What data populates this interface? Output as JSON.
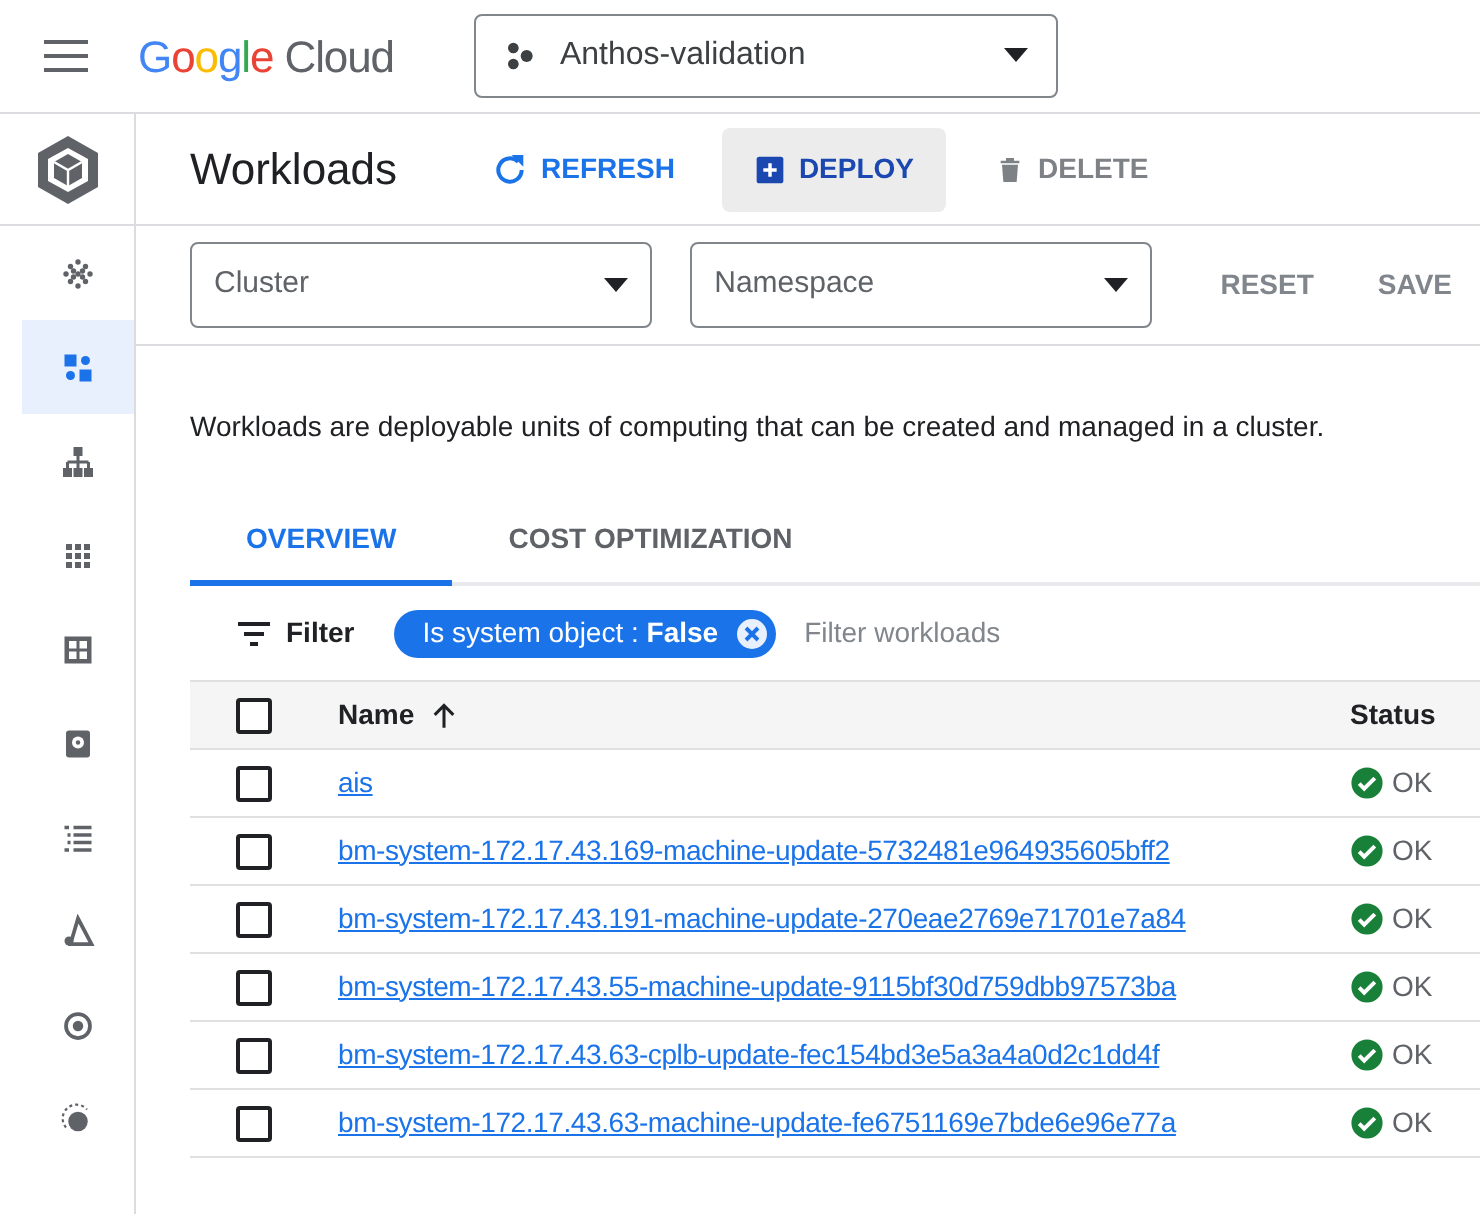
{
  "top_bar": {
    "logo": "Google Cloud",
    "project": "Anthos-validation"
  },
  "sidebar": {
    "items": [
      {
        "kind": "dots",
        "selected": false
      },
      {
        "kind": "workloads",
        "selected": true
      },
      {
        "kind": "hierarchy",
        "selected": false
      },
      {
        "kind": "grid",
        "selected": false
      },
      {
        "kind": "tiles",
        "selected": false
      },
      {
        "kind": "disk",
        "selected": false
      },
      {
        "kind": "list",
        "selected": false
      },
      {
        "kind": "triangle",
        "selected": false
      },
      {
        "kind": "target",
        "selected": false
      },
      {
        "kind": "orbit",
        "selected": false
      }
    ]
  },
  "header": {
    "title": "Workloads",
    "actions": [
      {
        "kind": "refresh",
        "label": "REFRESH",
        "disabled": false
      },
      {
        "kind": "deploy",
        "label": "DEPLOY",
        "disabled": false
      },
      {
        "kind": "delete",
        "label": "DELETE",
        "disabled": true
      }
    ]
  },
  "filters": {
    "selects": [
      {
        "placeholder": "Cluster"
      },
      {
        "placeholder": "Namespace"
      }
    ],
    "buttons": [
      "RESET",
      "SAVE"
    ]
  },
  "description": "Workloads are deployable units of computing that can be created and managed in a cluster.",
  "tabs": [
    {
      "label": "OVERVIEW",
      "selected": true
    },
    {
      "label": "COST OPTIMIZATION",
      "selected": false
    }
  ],
  "filter_bar": {
    "label": "Filter",
    "chip": "Is system object : **False**",
    "placeholder": "Filter workloads"
  },
  "table": {
    "all_checked": false,
    "columns": [
      "Name",
      "Status"
    ],
    "rows": [
      {
        "name": "ais",
        "status": "OK",
        "checked": false
      },
      {
        "name": "bm-system-172.17.43.169-machine-update-5732481e964935605bff2",
        "status": "OK",
        "checked": false
      },
      {
        "name": "bm-system-172.17.43.191-machine-update-270eae2769e71701e7a84",
        "status": "OK",
        "checked": false
      },
      {
        "name": "bm-system-172.17.43.55-machine-update-9115bf30d759dbb97573ba",
        "status": "OK",
        "checked": false
      },
      {
        "name": "bm-system-172.17.43.63-cplb-update-fec154bd3e5a3a4a0d2c1dd4f",
        "status": "OK",
        "checked": false
      },
      {
        "name": "bm-system-172.17.43.63-machine-update-fe6751169e7bde6e96e77a",
        "status": "OK",
        "checked": false
      }
    ]
  }
}
